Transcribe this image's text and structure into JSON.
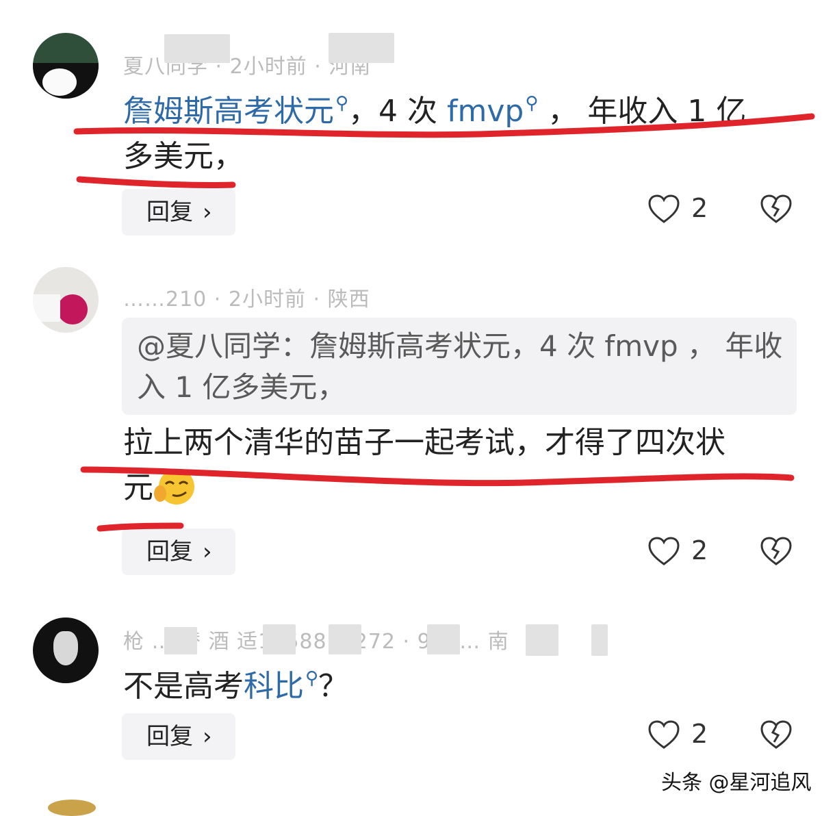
{
  "comments": [
    {
      "meta": "夏八同学 · 2小时前 · 河南",
      "text_link_1": "詹姆斯高考状元",
      "text_mid": "，4 次 ",
      "text_link_2": "fmvp",
      "text_rest_line1": " ， 年收入 1 亿",
      "text_line2": "多美元，",
      "reply_label": "回复",
      "likes": "2"
    },
    {
      "meta": "……210 · 2小时前 · 陕西",
      "quote_text": "@夏八同学：詹姆斯高考状元，4 次 fmvp ， 年收入 1 亿多美元，",
      "text_line1": "拉上两个清华的苗子一起考试，才得了四次状",
      "text_line2": "元",
      "reply_label": "回复",
      "likes": "2"
    },
    {
      "meta": "枪 … 替 酒 适1258814272 · 9小 … 南",
      "text_plain": "不是高考",
      "text_link": "科比",
      "text_tail": "？",
      "reply_label": "回复",
      "likes": "2"
    }
  ],
  "watermark": "头条 @星河追风",
  "colors": {
    "link": "#2e6aa8",
    "underline": "#e0242b",
    "meta": "#bbbbbb"
  },
  "icons": {
    "search_hint": "magnifier-icon",
    "like": "heart-outline-icon",
    "dislike": "broken-heart-icon",
    "chevron": "chevron-right-icon"
  }
}
